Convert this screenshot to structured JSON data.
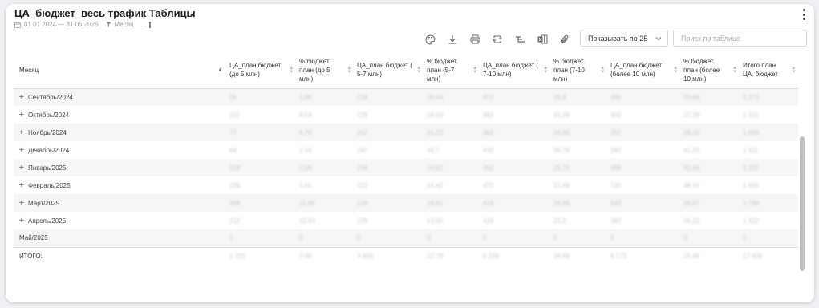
{
  "header": {
    "title": "ЦА_бюджет_весь трафик Таблицы",
    "date_range": "01.01.2024 — 31.05.2025",
    "filter_label": "Месяц",
    "more": "..."
  },
  "toolbar": {
    "icons": [
      "palette-icon",
      "download-icon",
      "print-icon",
      "refresh-icon",
      "hierarchy-icon",
      "excel-icon",
      "attach-icon"
    ]
  },
  "paging": {
    "select_label": "Показывать по 25"
  },
  "search": {
    "placeholder": "Поиск по таблице"
  },
  "table": {
    "columns": [
      "Месяц",
      "ЦА_план.бюджет (до 5 млн)",
      "% бюджет. план (до 5 млн)",
      "ЦА_план.бюджет ( 5-7 млн)",
      "% бюджет. план (5-7 млн)",
      "ЦА_план.бюджет ( 7-10 млн)",
      "% бюджет. план (7-10 млн)",
      "ЦА_план.бюджет (более 10 млн)",
      "% бюджет. план (более 10 млн)",
      "Итого план ЦА. бюджет"
    ],
    "rows": [
      {
        "month": "Сентябрь/2024",
        "expandable": true,
        "values": [
          "26",
          "1,86",
          "228",
          "18,64",
          "472",
          "35,8",
          "282",
          "20,69",
          "1 073"
        ]
      },
      {
        "month": "Октябрь/2024",
        "expandable": true,
        "values": [
          "112",
          "8,54",
          "228",
          "18,59",
          "462",
          "33,29",
          "302",
          "22,28",
          "1 311"
        ]
      },
      {
        "month": "Ноябрь/2024",
        "expandable": true,
        "values": [
          "77",
          "6,76",
          "252",
          "21,22",
          "462",
          "34,48",
          "352",
          "28,32",
          "1 693"
        ]
      },
      {
        "month": "Декабрь/2024",
        "expandable": true,
        "values": [
          "64",
          "2,19",
          "247",
          "18,7",
          "432",
          "35,78",
          "282",
          "41,23",
          "1 311"
        ]
      },
      {
        "month": "Январь/2025",
        "expandable": true,
        "values": [
          "218",
          "2,59",
          "238",
          "14,82",
          "262",
          "25,75",
          "688",
          "32,69",
          "1 332"
        ]
      },
      {
        "month": "Февраль/2025",
        "expandable": true,
        "values": [
          "238",
          "2,01",
          "222",
          "14,42",
          "472",
          "21,49",
          "720",
          "48,14",
          "1 693"
        ]
      },
      {
        "month": "Март/2025",
        "expandable": true,
        "values": [
          "208",
          "11,48",
          "228",
          "16,41",
          "424",
          "26,26",
          "642",
          "26,67",
          "1 798"
        ]
      },
      {
        "month": "Апрель/2025",
        "expandable": true,
        "values": [
          "212",
          "12,93",
          "228",
          "13,55",
          "428",
          "22,2",
          "382",
          "26,22",
          "1 322"
        ]
      },
      {
        "month": "Май/2025",
        "expandable": false,
        "values": [
          "0",
          "0",
          "0",
          "0",
          "0",
          "0",
          "0",
          "0",
          "0"
        ]
      }
    ],
    "total": {
      "label": "ИТОГО:",
      "values": [
        "1 220",
        "7,08",
        "3 993",
        "22,78",
        "6 226",
        "26,48",
        "6 172",
        "25,46",
        "17 606"
      ]
    }
  }
}
